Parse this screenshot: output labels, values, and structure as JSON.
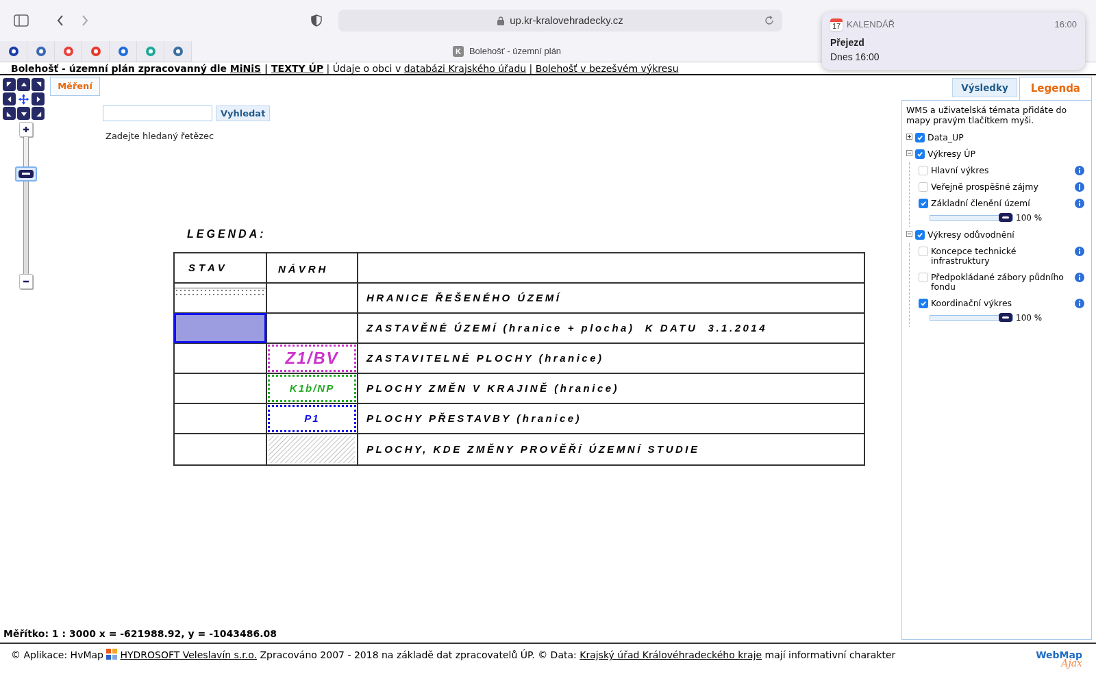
{
  "browser": {
    "address": "up.kr-kralovehradecky.cz",
    "tab_title": "Bolehošť - územní plán",
    "tab_favicon": "K"
  },
  "notification": {
    "app": "KALENDÁŘ",
    "app_icon_day": "17",
    "time": "16:00",
    "title": "Přejezd",
    "body": "Dnes 16:00"
  },
  "header": [
    {
      "kind": "bold",
      "text": "Bolehošť - územní plán zpracovanný dle "
    },
    {
      "kind": "bold_link",
      "text": "MiNiS"
    },
    {
      "kind": "bold",
      "text": " | "
    },
    {
      "kind": "bold_link",
      "text": "TEXTY ÚP"
    },
    {
      "kind": "text",
      "text": " | Údaje o obci v "
    },
    {
      "kind": "link",
      "text": "databázi Krajského úřadu"
    },
    {
      "kind": "text",
      "text": " | "
    },
    {
      "kind": "link",
      "text": "Bolehošť v bezešvém výkresu"
    }
  ],
  "map": {
    "measure_button": "Měření",
    "zoom": {
      "level": 0.76
    },
    "search": {
      "button": "Vyhledat",
      "hint": "Zadejte hledaný řetězec"
    },
    "legend": {
      "title": "LEGENDA:",
      "columns": [
        "STAV",
        "NÁVRH"
      ],
      "rows": [
        {
          "kind": "dotted",
          "text": "HRANICE ŘEŠENÉHO ÚZEMÍ"
        },
        {
          "kind": "filled",
          "color": "#9c9ce0",
          "text": "ZASTAVĚNÉ ÚZEMÍ (hranice + plocha)  K DATU  3.1.2014"
        },
        {
          "kind": "outlined",
          "color": "#cc33cc",
          "label": "Z1/BV",
          "text": "ZASTAVITELNÉ PLOCHY (hranice)"
        },
        {
          "kind": "outlined",
          "color": "#22aa22",
          "label": "K1b/NP",
          "text": "PLOCHY ZMĚN V KRAJINĚ (hranice)"
        },
        {
          "kind": "outlined",
          "color": "#1010ee",
          "label": "P1",
          "text": "PLOCHY PŘESTAVBY (hranice)"
        },
        {
          "kind": "hatched",
          "text": "PLOCHY, KDE ZMĚNY PROVĚŘÍ ÚZEMNÍ STUDIE"
        }
      ]
    },
    "scale": "Měřítko: 1 : 3000 x = -621988.92, y = -1043486.08"
  },
  "panel": {
    "tabs": [
      {
        "label": "Výsledky",
        "selected": false
      },
      {
        "label": "Legenda",
        "selected": true
      }
    ],
    "note": "WMS a uživatelská témata přidáte do mapy pravým tlačítkem myši.",
    "layers": [
      {
        "label": "Data_UP",
        "checked": true,
        "expanded": false
      },
      {
        "label": "Výkresy ÚP",
        "checked": true,
        "expanded": true,
        "children": [
          {
            "label": "Hlavní výkres",
            "checked": false
          },
          {
            "label": "Veřejně prospěšné zájmy",
            "checked": false
          },
          {
            "label": "Základní členění území",
            "checked": true,
            "opacity": {
              "level": 1,
              "reading": "100 %"
            }
          }
        ]
      },
      {
        "label": "Výkresy odůvodnění",
        "checked": true,
        "expanded": true,
        "children": [
          {
            "label": "Koncepce technické infrastruktury",
            "checked": false
          },
          {
            "label": "Předpokládané zábory půdního fondu",
            "checked": false
          },
          {
            "label": "Koordinační výkres",
            "checked": true,
            "opacity": {
              "level": 1,
              "reading": "100 %"
            }
          }
        ]
      }
    ]
  },
  "footer": [
    {
      "kind": "text",
      "text": "© Aplikace: HvMap "
    },
    {
      "kind": "logo"
    },
    {
      "kind": "link",
      "text": "HYDROSOFT Veleslavín s.r.o."
    },
    {
      "kind": "text",
      "text": " Zpracováno 2007 - 2018 na základě dat zpracovatelů ÚP. © Data: "
    },
    {
      "kind": "link",
      "text": "Krajský úřad Královéhradeckého kraje"
    },
    {
      "kind": "text",
      "text": " mají informativní charakter"
    }
  ],
  "footer_logo": {
    "word": "WebMap",
    "sub": "Ajax"
  }
}
